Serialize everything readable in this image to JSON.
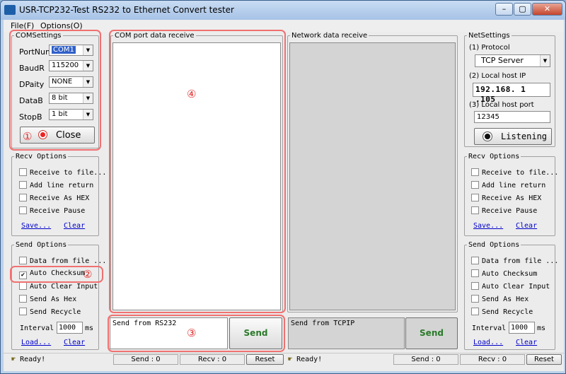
{
  "window": {
    "title": "USR-TCP232-Test  RS232 to Ethernet Convert tester",
    "min": "–",
    "max": "▢",
    "close": "✕"
  },
  "menu": [
    "File(F)",
    "Options(O)"
  ],
  "com": {
    "legend": "COMSettings",
    "fields": [
      {
        "label": "PortNum",
        "value": "COM1"
      },
      {
        "label": "BaudR",
        "value": "115200"
      },
      {
        "label": "DPaity",
        "value": "NONE"
      },
      {
        "label": "DataB",
        "value": "8 bit"
      },
      {
        "label": "StopB",
        "value": "1 bit"
      }
    ],
    "close": "Close"
  },
  "left_recv": {
    "legend": "Recv Options",
    "items": [
      "Receive to file...",
      "Add line return",
      "Receive As HEX",
      "Receive Pause"
    ],
    "save": "Save...",
    "clear": "Clear"
  },
  "left_send": {
    "legend": "Send Options",
    "items": [
      {
        "label": "Data from file ...",
        "checked": false
      },
      {
        "label": "Auto Checksum",
        "checked": true
      },
      {
        "label": "Auto Clear Input",
        "checked": false
      },
      {
        "label": "Send As Hex",
        "checked": false
      },
      {
        "label": "Send Recycle",
        "checked": false
      }
    ],
    "interval_label": "Interval",
    "interval": "1000",
    "unit": "ms",
    "load": "Load...",
    "clear": "Clear"
  },
  "com_recv": {
    "legend": "COM port data receive"
  },
  "net_recv": {
    "legend": "Network data receive"
  },
  "com_send": {
    "text": "Send from RS232",
    "button": "Send"
  },
  "net_send": {
    "text": "Send from TCPIP",
    "button": "Send"
  },
  "net": {
    "legend": "NetSettings",
    "protocol_label": "(1) Protocol",
    "protocol": "TCP Server",
    "ip_label": "(2) Local host IP",
    "ip": "192.168. 1 .105",
    "port_label": "(3) Local host port",
    "port": "12345",
    "listen": "Listening"
  },
  "right_recv": {
    "legend": "Recv Options",
    "items": [
      "Receive to file...",
      "Add line return",
      "Receive As HEX",
      "Receive Pause"
    ],
    "save": "Save...",
    "clear": "Clear"
  },
  "right_send": {
    "legend": "Send Options",
    "items": [
      {
        "label": "Data from file ...",
        "checked": false
      },
      {
        "label": "Auto Checksum",
        "checked": false
      },
      {
        "label": "Auto Clear Input",
        "checked": false
      },
      {
        "label": "Send As Hex",
        "checked": false
      },
      {
        "label": "Send Recycle",
        "checked": false
      }
    ],
    "interval_label": "Interval",
    "interval": "1000",
    "unit": "ms",
    "load": "Load...",
    "clear": "Clear"
  },
  "status": {
    "left_ready": "Ready!",
    "left_send": "Send : 0",
    "left_recv": "Recv : 0",
    "left_reset": "Reset",
    "right_ready": "Ready!",
    "right_send": "Send : 0",
    "right_recv": "Recv : 0",
    "right_reset": "Reset"
  },
  "annotations": [
    "①",
    "②",
    "③",
    "④"
  ],
  "colors": {
    "annotation": "#f07070",
    "link": "#0000cc",
    "send_text": "#2a7a2a",
    "selection": "#3060c8"
  }
}
